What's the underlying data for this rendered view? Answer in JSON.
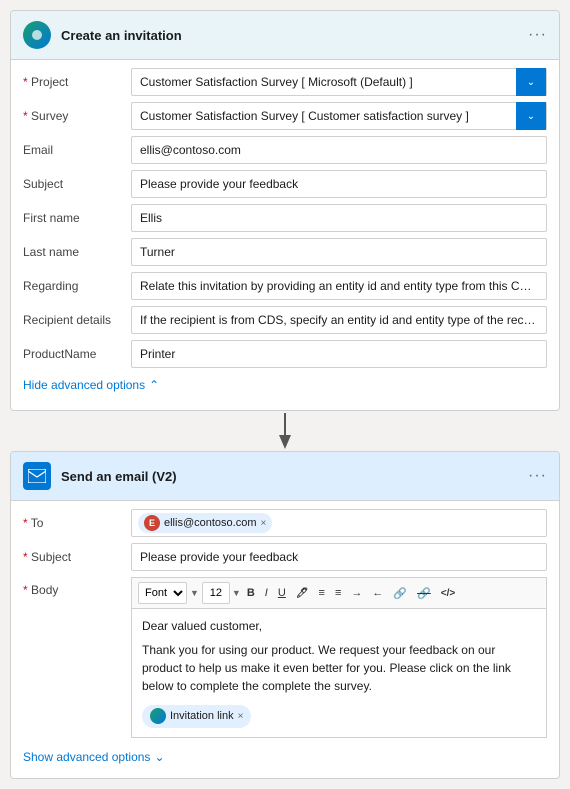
{
  "card1": {
    "title": "Create an invitation",
    "fields": {
      "project_label": "Project",
      "project_value": "Customer Satisfaction Survey [ Microsoft (Default) ]",
      "survey_label": "Survey",
      "survey_value": "Customer Satisfaction Survey [ Customer satisfaction survey ]",
      "email_label": "Email",
      "email_value": "ellis@contoso.com",
      "subject_label": "Subject",
      "subject_value": "Please provide your feedback",
      "firstname_label": "First name",
      "firstname_value": "Ellis",
      "lastname_label": "Last name",
      "lastname_value": "Turner",
      "regarding_label": "Regarding",
      "regarding_value": "Relate this invitation by providing an entity id and entity type from this CDS in t",
      "recipient_label": "Recipient details",
      "recipient_value": "If the recipient is from CDS, specify an entity id and entity type of the recipient",
      "productname_label": "ProductName",
      "productname_value": "Printer"
    },
    "hide_advanced": "Hide advanced options"
  },
  "card2": {
    "title": "Send an email (V2)",
    "to_label": "To",
    "to_value": "ellis@contoso.com",
    "to_avatar": "E",
    "subject_label": "Subject",
    "subject_value": "Please provide your feedback",
    "body_label": "Body",
    "toolbar": {
      "font": "Font",
      "font_size": "12",
      "bold": "B",
      "italic": "I",
      "underline": "U"
    },
    "body_text1": "Dear valued customer,",
    "body_text2": "Thank you for using our product. We request your feedback on our product to help us make it even better for you. Please click on the link below to complete the complete the survey.",
    "invitation_link_label": "Invitation link",
    "show_advanced": "Show advanced options"
  }
}
